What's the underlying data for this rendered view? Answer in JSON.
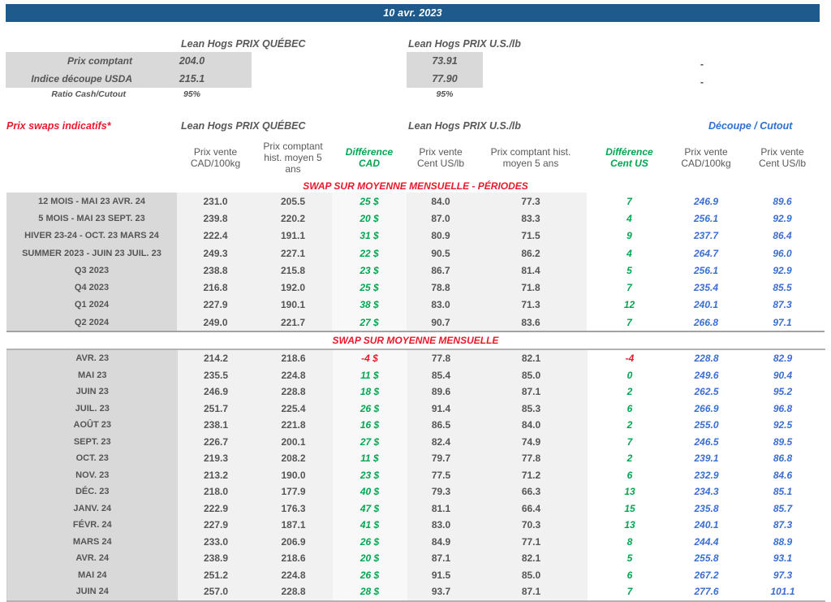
{
  "banner": {
    "date": "10 avr. 2023"
  },
  "spot": {
    "qc_heading": "Lean Hogs PRIX QUÉBEC",
    "us_heading": "Lean Hogs PRIX U.S./lb",
    "rows": [
      {
        "label": "Prix comptant",
        "qc": "204.0",
        "us": "73.91"
      },
      {
        "label": "Indice découpe USDA",
        "qc": "215.1",
        "us": "77.90"
      }
    ],
    "ratio_label": "Ratio Cash/Cutout",
    "ratio_qc": "95%",
    "ratio_us": "95%",
    "dash_row1": "-",
    "dash_row2": "-"
  },
  "swaps": {
    "title": "Prix swaps indicatifs*",
    "group_qc": "Lean Hogs PRIX QUÉBEC",
    "group_us": "Lean Hogs PRIX U.S./lb",
    "group_cutout": "Découpe / Cutout",
    "column_headers": [
      {
        "text": "Prix vente\nCAD/100kg",
        "green": false
      },
      {
        "text": "Prix comptant\nhist. moyen 5\nans",
        "green": false
      },
      {
        "text": "Différence\nCAD",
        "green": true
      },
      {
        "text": "Prix vente\nCent US/lb",
        "green": false
      },
      {
        "text": "Prix comptant hist.\nmoyen 5 ans",
        "green": false
      },
      {
        "text": "Différence\nCent US",
        "green": true
      },
      {
        "text": "Prix vente\nCAD/100kg",
        "green": false
      },
      {
        "text": "Prix vente\nCent US/lb",
        "green": false
      }
    ],
    "periods_title": "SWAP SUR MOYENNE MENSUELLE - PÉRIODES",
    "monthly_title": "SWAP SUR MOYENNE MENSUELLE",
    "periods": [
      [
        "12 MOIS - MAI 23 AVR. 24",
        "231.0",
        "205.5",
        "25 $",
        "84.0",
        "77.3",
        "7",
        "246.9",
        "89.6"
      ],
      [
        "5 MOIS - MAI 23 SEPT. 23",
        "239.8",
        "220.2",
        "20 $",
        "87.0",
        "83.3",
        "4",
        "256.1",
        "92.9"
      ],
      [
        "HIVER 23-24 -  OCT. 23 MARS 24",
        "222.4",
        "191.1",
        "31 $",
        "80.9",
        "71.5",
        "9",
        "237.7",
        "86.4"
      ],
      [
        "SUMMER 2023 - JUIN 23 JUIL. 23",
        "249.3",
        "227.1",
        "22 $",
        "90.5",
        "86.2",
        "4",
        "264.7",
        "96.0"
      ],
      [
        "Q3 2023",
        "238.8",
        "215.8",
        "23 $",
        "86.7",
        "81.4",
        "5",
        "256.1",
        "92.9"
      ],
      [
        "Q4 2023",
        "216.8",
        "192.0",
        "25 $",
        "78.8",
        "71.8",
        "7",
        "235.4",
        "85.5"
      ],
      [
        "Q1 2024",
        "227.9",
        "190.1",
        "38 $",
        "83.0",
        "71.3",
        "12",
        "240.1",
        "87.3"
      ],
      [
        "Q2 2024",
        "249.0",
        "221.7",
        "27 $",
        "90.7",
        "83.6",
        "7",
        "266.8",
        "97.1"
      ]
    ],
    "monthly": [
      [
        "AVR. 23",
        "214.2",
        "218.6",
        "-4 $",
        "77.8",
        "82.1",
        "-4",
        "228.8",
        "82.9"
      ],
      [
        "MAI 23",
        "235.5",
        "224.8",
        "11 $",
        "85.4",
        "85.0",
        "0",
        "249.6",
        "90.4"
      ],
      [
        "JUIN 23",
        "246.9",
        "228.8",
        "18 $",
        "89.6",
        "87.1",
        "2",
        "262.5",
        "95.2"
      ],
      [
        "JUIL. 23",
        "251.7",
        "225.4",
        "26 $",
        "91.4",
        "85.3",
        "6",
        "266.9",
        "96.8"
      ],
      [
        "AOÛT 23",
        "238.1",
        "221.8",
        "16 $",
        "86.5",
        "84.0",
        "2",
        "255.0",
        "92.5"
      ],
      [
        "SEPT. 23",
        "226.7",
        "200.1",
        "27 $",
        "82.4",
        "74.9",
        "7",
        "246.5",
        "89.5"
      ],
      [
        "OCT. 23",
        "219.3",
        "208.2",
        "11 $",
        "79.7",
        "77.8",
        "2",
        "239.1",
        "86.8"
      ],
      [
        "NOV. 23",
        "213.2",
        "190.0",
        "23 $",
        "77.5",
        "71.2",
        "6",
        "232.9",
        "84.6"
      ],
      [
        "DÉC. 23",
        "218.0",
        "177.9",
        "40 $",
        "79.3",
        "66.3",
        "13",
        "234.3",
        "85.1"
      ],
      [
        "JANV. 24",
        "222.9",
        "176.3",
        "47 $",
        "81.1",
        "66.4",
        "15",
        "235.8",
        "85.7"
      ],
      [
        "FÉVR. 24",
        "227.9",
        "187.1",
        "41 $",
        "83.0",
        "70.3",
        "13",
        "240.1",
        "87.3"
      ],
      [
        "MARS 24",
        "233.0",
        "206.9",
        "26 $",
        "84.9",
        "77.1",
        "8",
        "244.4",
        "88.9"
      ],
      [
        "AVR. 24",
        "238.9",
        "218.6",
        "20 $",
        "87.1",
        "82.1",
        "5",
        "255.8",
        "93.1"
      ],
      [
        "MAI 24",
        "251.2",
        "224.8",
        "26 $",
        "91.5",
        "85.0",
        "6",
        "267.2",
        "97.3"
      ],
      [
        "JUIN 24",
        "257.0",
        "228.8",
        "28 $",
        "93.7",
        "87.1",
        "7",
        "277.6",
        "101.1"
      ]
    ]
  },
  "colors": {
    "banner_blue": "#1E5A8C",
    "title_red": "#E8192C",
    "diff_green": "#00A651",
    "cutout_blue": "#3A6ED0",
    "text_gray": "#555555",
    "label_bg": "#D9D9D9",
    "value_bg": "#F1F1F1",
    "diff_bg": "#F8F8F8"
  }
}
